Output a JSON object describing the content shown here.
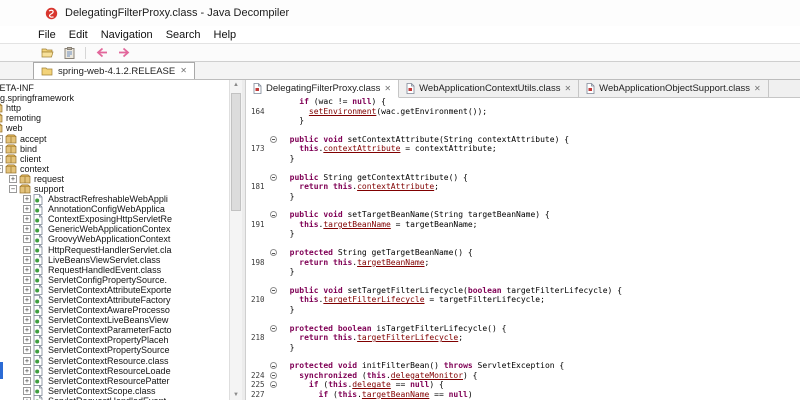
{
  "titlebar": {
    "title": "DelegatingFilterProxy.class - Java Decompiler"
  },
  "menubar": {
    "items": [
      "File",
      "Edit",
      "Navigation",
      "Search",
      "Help"
    ]
  },
  "toolbar": {
    "icons": [
      "open-archive-icon",
      "paste-icon",
      "back-icon",
      "forward-icon"
    ]
  },
  "archive_bar": {
    "label": "spring-web-4.1.2.RELEASE",
    "close_glyph": "✕"
  },
  "colors": {
    "keyword": "#7f0055",
    "reference": "#800000",
    "line_number": "#3a3a3a"
  },
  "tree": {
    "items": [
      {
        "depth": 0,
        "kind": "folder",
        "exp": "+",
        "label": "META-INF"
      },
      {
        "depth": 0,
        "kind": "package",
        "exp": "-",
        "label": "org.springframework"
      },
      {
        "depth": 1,
        "kind": "package",
        "exp": "+",
        "label": "http"
      },
      {
        "depth": 1,
        "kind": "package",
        "exp": "+",
        "label": "remoting"
      },
      {
        "depth": 1,
        "kind": "package",
        "exp": "-",
        "label": "web"
      },
      {
        "depth": 2,
        "kind": "package",
        "exp": "+",
        "label": "accept"
      },
      {
        "depth": 2,
        "kind": "package",
        "exp": "+",
        "label": "bind"
      },
      {
        "depth": 2,
        "kind": "package",
        "exp": "+",
        "label": "client"
      },
      {
        "depth": 2,
        "kind": "package",
        "exp": "-",
        "label": "context"
      },
      {
        "depth": 3,
        "kind": "package",
        "exp": "+",
        "label": "request"
      },
      {
        "depth": 3,
        "kind": "package",
        "exp": "-",
        "label": "support"
      },
      {
        "depth": 4,
        "kind": "class",
        "exp": "+",
        "label": "AbstractRefreshableWebAppli"
      },
      {
        "depth": 4,
        "kind": "class",
        "exp": "+",
        "label": "AnnotationConfigWebApplica"
      },
      {
        "depth": 4,
        "kind": "class",
        "exp": "+",
        "label": "ContextExposingHttpServletRe"
      },
      {
        "depth": 4,
        "kind": "class",
        "exp": "+",
        "label": "GenericWebApplicationContex"
      },
      {
        "depth": 4,
        "kind": "class",
        "exp": "+",
        "label": "GroovyWebApplicationContext"
      },
      {
        "depth": 4,
        "kind": "class",
        "exp": "+",
        "label": "HttpRequestHandlerServlet.cla"
      },
      {
        "depth": 4,
        "kind": "class",
        "exp": "+",
        "label": "LiveBeansViewServlet.class"
      },
      {
        "depth": 4,
        "kind": "class",
        "exp": "+",
        "label": "RequestHandledEvent.class"
      },
      {
        "depth": 4,
        "kind": "class",
        "exp": "+",
        "label": "ServletConfigPropertySource."
      },
      {
        "depth": 4,
        "kind": "class",
        "exp": "+",
        "label": "ServletContextAttributeExporte"
      },
      {
        "depth": 4,
        "kind": "class",
        "exp": "+",
        "label": "ServletContextAttributeFactory"
      },
      {
        "depth": 4,
        "kind": "class",
        "exp": "+",
        "label": "ServletContextAwareProcesso"
      },
      {
        "depth": 4,
        "kind": "class",
        "exp": "+",
        "label": "ServletContextLiveBeansView"
      },
      {
        "depth": 4,
        "kind": "class",
        "exp": "+",
        "label": "ServletContextParameterFacto"
      },
      {
        "depth": 4,
        "kind": "class",
        "exp": "+",
        "label": "ServletContextPropertyPlaceh"
      },
      {
        "depth": 4,
        "kind": "class",
        "exp": "+",
        "label": "ServletContextPropertySource"
      },
      {
        "depth": 4,
        "kind": "class",
        "exp": "+",
        "label": "ServletContextResource.class"
      },
      {
        "depth": 4,
        "kind": "class",
        "exp": "+",
        "label": "ServletContextResourceLoade"
      },
      {
        "depth": 4,
        "kind": "class",
        "exp": "+",
        "label": "ServletContextResourcePatter"
      },
      {
        "depth": 4,
        "kind": "class",
        "exp": "+",
        "label": "ServletContextScope.class"
      },
      {
        "depth": 4,
        "kind": "class",
        "exp": "+",
        "label": "ServletRequestHandledEvent."
      }
    ]
  },
  "editor": {
    "close_glyph": "✕",
    "tabs": [
      {
        "label": "DelegatingFilterProxy.class",
        "active": true
      },
      {
        "label": "WebApplicationContextUtils.class",
        "active": false
      },
      {
        "label": "WebApplicationObjectSupport.class",
        "active": false
      }
    ],
    "code_lines": [
      {
        "n": "",
        "f": false,
        "t": [
          [
            "p",
            "    "
          ],
          [
            "k",
            "if"
          ],
          [
            "p",
            " (wac != "
          ],
          [
            "k",
            "null"
          ],
          [
            "p",
            ") {"
          ]
        ]
      },
      {
        "n": "164",
        "f": false,
        "t": [
          [
            "p",
            "      "
          ],
          [
            "r",
            "setEnvironment"
          ],
          [
            "p",
            "(wac.getEnvironment());"
          ]
        ]
      },
      {
        "n": "",
        "f": false,
        "t": [
          [
            "p",
            "    }"
          ]
        ]
      },
      {
        "n": "",
        "f": false,
        "t": []
      },
      {
        "n": "",
        "f": true,
        "t": [
          [
            "p",
            "  "
          ],
          [
            "k",
            "public"
          ],
          [
            "p",
            " "
          ],
          [
            "k",
            "void"
          ],
          [
            "p",
            " setContextAttribute(String contextAttribute) {"
          ]
        ]
      },
      {
        "n": "173",
        "f": false,
        "t": [
          [
            "p",
            "    "
          ],
          [
            "k",
            "this"
          ],
          [
            "p",
            "."
          ],
          [
            "r",
            "contextAttribute"
          ],
          [
            "p",
            " = contextAttribute;"
          ]
        ]
      },
      {
        "n": "",
        "f": false,
        "t": [
          [
            "p",
            "  }"
          ]
        ]
      },
      {
        "n": "",
        "f": false,
        "t": []
      },
      {
        "n": "",
        "f": true,
        "t": [
          [
            "p",
            "  "
          ],
          [
            "k",
            "public"
          ],
          [
            "p",
            " String getContextAttribute() {"
          ]
        ]
      },
      {
        "n": "181",
        "f": false,
        "t": [
          [
            "p",
            "    "
          ],
          [
            "k",
            "return"
          ],
          [
            "p",
            " "
          ],
          [
            "k",
            "this"
          ],
          [
            "p",
            "."
          ],
          [
            "r",
            "contextAttribute"
          ],
          [
            "p",
            ";"
          ]
        ]
      },
      {
        "n": "",
        "f": false,
        "t": [
          [
            "p",
            "  }"
          ]
        ]
      },
      {
        "n": "",
        "f": false,
        "t": []
      },
      {
        "n": "",
        "f": true,
        "t": [
          [
            "p",
            "  "
          ],
          [
            "k",
            "public"
          ],
          [
            "p",
            " "
          ],
          [
            "k",
            "void"
          ],
          [
            "p",
            " setTargetBeanName(String targetBeanName) {"
          ]
        ]
      },
      {
        "n": "191",
        "f": false,
        "t": [
          [
            "p",
            "    "
          ],
          [
            "k",
            "this"
          ],
          [
            "p",
            "."
          ],
          [
            "r",
            "targetBeanName"
          ],
          [
            "p",
            " = targetBeanName;"
          ]
        ]
      },
      {
        "n": "",
        "f": false,
        "t": [
          [
            "p",
            "  }"
          ]
        ]
      },
      {
        "n": "",
        "f": false,
        "t": []
      },
      {
        "n": "",
        "f": true,
        "t": [
          [
            "p",
            "  "
          ],
          [
            "k",
            "protected"
          ],
          [
            "p",
            " String getTargetBeanName() {"
          ]
        ]
      },
      {
        "n": "198",
        "f": false,
        "t": [
          [
            "p",
            "    "
          ],
          [
            "k",
            "return"
          ],
          [
            "p",
            " "
          ],
          [
            "k",
            "this"
          ],
          [
            "p",
            "."
          ],
          [
            "r",
            "targetBeanName"
          ],
          [
            "p",
            ";"
          ]
        ]
      },
      {
        "n": "",
        "f": false,
        "t": [
          [
            "p",
            "  }"
          ]
        ]
      },
      {
        "n": "",
        "f": false,
        "t": []
      },
      {
        "n": "",
        "f": true,
        "t": [
          [
            "p",
            "  "
          ],
          [
            "k",
            "public"
          ],
          [
            "p",
            " "
          ],
          [
            "k",
            "void"
          ],
          [
            "p",
            " setTargetFilterLifecycle("
          ],
          [
            "k",
            "boolean"
          ],
          [
            "p",
            " targetFilterLifecycle) {"
          ]
        ]
      },
      {
        "n": "210",
        "f": false,
        "t": [
          [
            "p",
            "    "
          ],
          [
            "k",
            "this"
          ],
          [
            "p",
            "."
          ],
          [
            "r",
            "targetFilterLifecycle"
          ],
          [
            "p",
            " = targetFilterLifecycle;"
          ]
        ]
      },
      {
        "n": "",
        "f": false,
        "t": [
          [
            "p",
            "  }"
          ]
        ]
      },
      {
        "n": "",
        "f": false,
        "t": []
      },
      {
        "n": "",
        "f": true,
        "t": [
          [
            "p",
            "  "
          ],
          [
            "k",
            "protected"
          ],
          [
            "p",
            " "
          ],
          [
            "k",
            "boolean"
          ],
          [
            "p",
            " isTargetFilterLifecycle() {"
          ]
        ]
      },
      {
        "n": "218",
        "f": false,
        "t": [
          [
            "p",
            "    "
          ],
          [
            "k",
            "return"
          ],
          [
            "p",
            " "
          ],
          [
            "k",
            "this"
          ],
          [
            "p",
            "."
          ],
          [
            "r",
            "targetFilterLifecycle"
          ],
          [
            "p",
            ";"
          ]
        ]
      },
      {
        "n": "",
        "f": false,
        "t": [
          [
            "p",
            "  }"
          ]
        ]
      },
      {
        "n": "",
        "f": false,
        "t": []
      },
      {
        "n": "",
        "f": true,
        "t": [
          [
            "p",
            "  "
          ],
          [
            "k",
            "protected"
          ],
          [
            "p",
            " "
          ],
          [
            "k",
            "void"
          ],
          [
            "p",
            " initFilterBean() "
          ],
          [
            "k",
            "throws"
          ],
          [
            "p",
            " ServletException {"
          ]
        ]
      },
      {
        "n": "224",
        "f": true,
        "t": [
          [
            "p",
            "    "
          ],
          [
            "k",
            "synchronized"
          ],
          [
            "p",
            " ("
          ],
          [
            "k",
            "this"
          ],
          [
            "p",
            "."
          ],
          [
            "r",
            "delegateMonitor"
          ],
          [
            "p",
            ") {"
          ]
        ]
      },
      {
        "n": "225",
        "f": true,
        "t": [
          [
            "p",
            "      "
          ],
          [
            "k",
            "if"
          ],
          [
            "p",
            " ("
          ],
          [
            "k",
            "this"
          ],
          [
            "p",
            "."
          ],
          [
            "r",
            "delegate"
          ],
          [
            "p",
            " == "
          ],
          [
            "k",
            "null"
          ],
          [
            "p",
            ") {"
          ]
        ]
      },
      {
        "n": "227",
        "f": false,
        "t": [
          [
            "p",
            "        "
          ],
          [
            "k",
            "if"
          ],
          [
            "p",
            " ("
          ],
          [
            "k",
            "this"
          ],
          [
            "p",
            "."
          ],
          [
            "r",
            "targetBeanName"
          ],
          [
            "p",
            " == "
          ],
          [
            "k",
            "null"
          ],
          [
            "p",
            ")"
          ]
        ]
      }
    ]
  }
}
